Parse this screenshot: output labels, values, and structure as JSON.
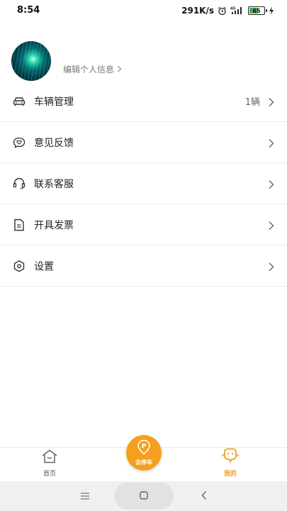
{
  "status_bar": {
    "time": "8:54",
    "network_speed": "291K/s",
    "network_type": "4G",
    "battery_level": "65",
    "battery_percent": 65,
    "icons": [
      "alarm-icon",
      "signal-icon",
      "battery-icon",
      "charging-icon"
    ]
  },
  "profile": {
    "edit_label": "编辑个人信息"
  },
  "menu": {
    "items": [
      {
        "label": "车辆管理",
        "value": "1辆",
        "icon": "car-icon"
      },
      {
        "label": "意见反馈",
        "value": "",
        "icon": "feedback-icon"
      },
      {
        "label": "联系客服",
        "value": "",
        "icon": "headset-icon"
      },
      {
        "label": "开具发票",
        "value": "",
        "icon": "invoice-icon"
      },
      {
        "label": "设置",
        "value": "",
        "icon": "settings-icon"
      }
    ]
  },
  "tab_bar": {
    "home_label": "首页",
    "center_label": "去停车",
    "mine_label": "我的",
    "active_tab": "我的"
  },
  "colors": {
    "accent": "#f5a01c",
    "active_tab": "#f29b1f",
    "divider": "#ececec"
  }
}
